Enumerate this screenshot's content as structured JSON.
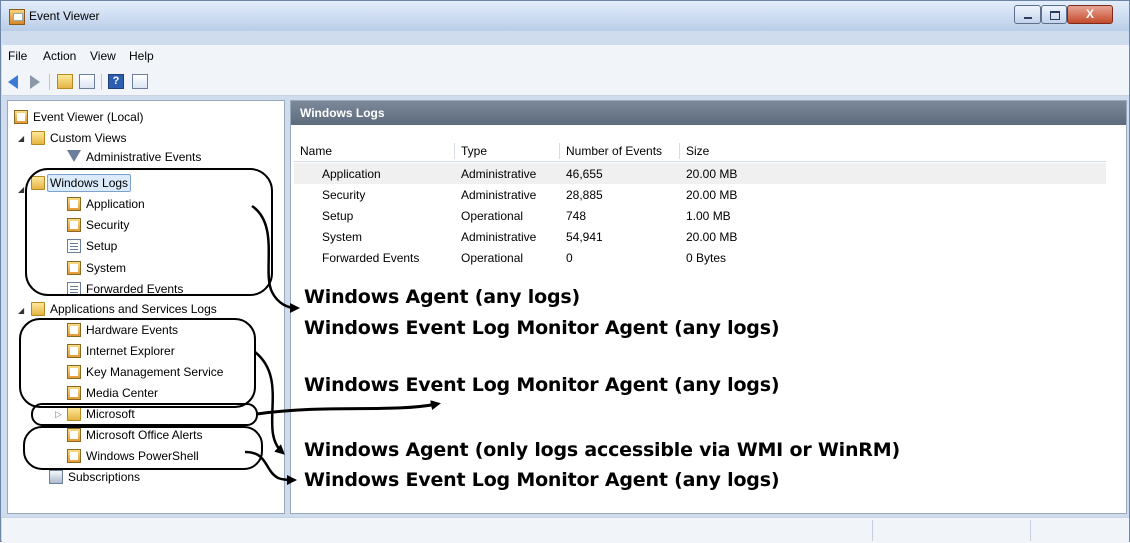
{
  "window": {
    "title": "Event Viewer"
  },
  "title_controls": {
    "close_glyph": "X"
  },
  "menu": [
    "File",
    "Action",
    "View",
    "Help"
  ],
  "toolbar": {
    "icons": [
      "back-arrow-icon",
      "forward-arrow-icon",
      "up-folder-icon",
      "show-hide-console-tree-icon",
      "help-icon",
      "show-hide-action-pane-icon"
    ],
    "help_glyph": "?"
  },
  "tree": {
    "root": "Event Viewer (Local)",
    "custom_views": "Custom Views",
    "administrative_events": "Administrative Events",
    "windows_logs": "Windows Logs",
    "windows_logs_children": [
      "Application",
      "Security",
      "Setup",
      "System",
      "Forwarded Events"
    ],
    "apps_services": "Applications and Services Logs",
    "apps_services_children": [
      "Hardware Events",
      "Internet Explorer",
      "Key Management Service",
      "Media Center",
      "Microsoft",
      "Microsoft Office Alerts",
      "Windows PowerShell"
    ],
    "subscriptions": "Subscriptions"
  },
  "content": {
    "header": "Windows Logs",
    "columns": [
      "Name",
      "Type",
      "Number of Events",
      "Size"
    ],
    "rows": [
      [
        "Application",
        "Administrative",
        "46,655",
        "20.00 MB"
      ],
      [
        "Security",
        "Administrative",
        "28,885",
        "20.00 MB"
      ],
      [
        "Setup",
        "Operational",
        "748",
        "1.00 MB"
      ],
      [
        "System",
        "Administrative",
        "54,941",
        "20.00 MB"
      ],
      [
        "Forwarded Events",
        "Operational",
        "0",
        "0 Bytes"
      ]
    ]
  },
  "annotations": [
    "Windows Agent (any logs)",
    "Windows Event Log Monitor Agent (any logs)",
    "Windows Event Log Monitor Agent (any logs)",
    "Windows Agent (only logs accessible via WMI or WinRM)",
    "Windows Event Log Monitor Agent (any logs)"
  ]
}
